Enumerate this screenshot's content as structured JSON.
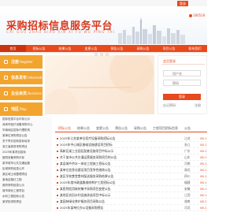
{
  "topbar": {
    "login_label": "登录",
    "phone": "180518"
  },
  "header": {
    "title": "采购招标信息服务平台",
    "subtitle": "CAI GOU ZHAO BIAO XIN XI FU WU PING TAI"
  },
  "nav": [
    "首页",
    "招标公告",
    "结果公告",
    "变更公告",
    "预告公告",
    "采购公告",
    "项目公告",
    "联系我们"
  ],
  "side_buttons": [
    {
      "label": "注册",
      "en": "Register"
    },
    {
      "label": "信息发布",
      "en": "Information"
    },
    {
      "label": "企业会员",
      "en": "Business"
    },
    {
      "label": "地区",
      "en": "Map"
    }
  ],
  "login_box": {
    "title": "会员登录",
    "username_placeholder": "用户名",
    "password_placeholder": "密码",
    "submit": "登录",
    "forgot": "忘记密码",
    "register": "注册"
  },
  "left_list": [
    "招标信息平台中标公示",
    "深圳市医疗设备采购中心",
    "华南地区招标代理机构",
    "某单位采购项目公告",
    "关于举办招标投标培训",
    "浙江省政府采购项目",
    "2025年某项目招标",
    "医院设备采购中标",
    "某市城市公共交通运营",
    "区域采购信息公开",
    "某区域土地整理项目",
    "某地区路灯工程",
    "政府采购信息公示",
    "城市绿化工程项目",
    "水利工程招标公告",
    "某学校采购项目"
  ],
  "tabs": [
    "招标公告",
    "结果公告",
    "变更公告",
    "预告公告",
    "采购公告",
    "工程项目招标信息",
    "公告"
  ],
  "rows": [
    {
      "title": "2025年江苏某单位医疗设备采购招标公告",
      "region": "江苏",
      "date": "08-1"
    },
    {
      "title": "2025年中心城区基础设施建设项目招标",
      "region": "浙江",
      "date": "08-1"
    },
    {
      "title": "高新区某工业园区配套设施项目中标公示",
      "region": "广东",
      "date": "08-1"
    },
    {
      "title": "关于某市公共交通运营服务采购项目的公告",
      "region": "山东",
      "date": "08-1"
    },
    {
      "title": "某县城乡供水一体化工程施工招标公告",
      "region": "河南",
      "date": "08-1"
    },
    {
      "title": "某单位信息化建设项目竞争性磋商公告",
      "region": "湖北",
      "date": "08-1"
    },
    {
      "title": "某区学校食堂食材配送服务采购结果公告",
      "region": "四川",
      "date": "08-1"
    },
    {
      "title": "2025年度市政道路维修养护工程招标公告",
      "region": "福建",
      "date": "08-1"
    },
    {
      "title": "某医院医用耗材集中采购项目变更公告",
      "region": "安徽",
      "date": "08-1"
    },
    {
      "title": "某地区农田水利设施改造项目中标公示",
      "region": "江西",
      "date": "08-1"
    },
    {
      "title": "某园林绿化养护服务项目采购公告",
      "region": "湖南",
      "date": "08-1"
    },
    {
      "title": "2025年某单位办公设备采购预告",
      "region": "河北",
      "date": "08-1"
    }
  ],
  "colors": {
    "accent": "#e8491d",
    "orange": "#f3a42e"
  }
}
